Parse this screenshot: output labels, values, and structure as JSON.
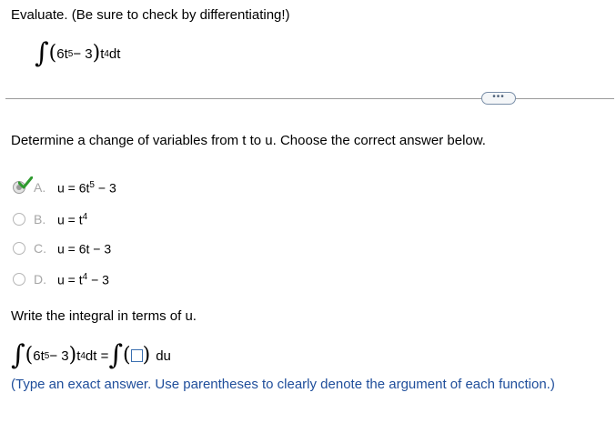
{
  "question": {
    "instruction": "Evaluate. (Be sure to check by differentiating!)",
    "integral": {
      "sign": "∫",
      "open_paren": "(",
      "inner_base": "6t",
      "inner_exp": "5",
      "inner_rest": " − 3",
      "close_paren": ")",
      "factor_base": " t",
      "factor_exp": "4",
      "differential": " dt"
    }
  },
  "more_button": {
    "label": "•••"
  },
  "part1": {
    "prompt": "Determine a change of variables from t to u. Choose the correct answer below.",
    "selected": "A",
    "options": [
      {
        "letter": "A.",
        "prefix": "u = 6t",
        "exp": "5",
        "suffix": " − 3"
      },
      {
        "letter": "B.",
        "prefix": "u = t",
        "exp": "4",
        "suffix": ""
      },
      {
        "letter": "C.",
        "prefix": "u = 6t − 3",
        "exp": "",
        "suffix": ""
      },
      {
        "letter": "D.",
        "prefix": "u = t",
        "exp": "4",
        "suffix": " − 3"
      }
    ]
  },
  "part2": {
    "prompt": "Write the integral in terms of u.",
    "equals": " dt = ",
    "answer_value": "",
    "du": " du",
    "hint": "(Type an exact answer. Use parentheses to clearly denote the argument of each function.)"
  },
  "colors": {
    "check": "#2e9a2e",
    "hint_text": "#1f4e9b",
    "divider": "#9b9b9b"
  }
}
